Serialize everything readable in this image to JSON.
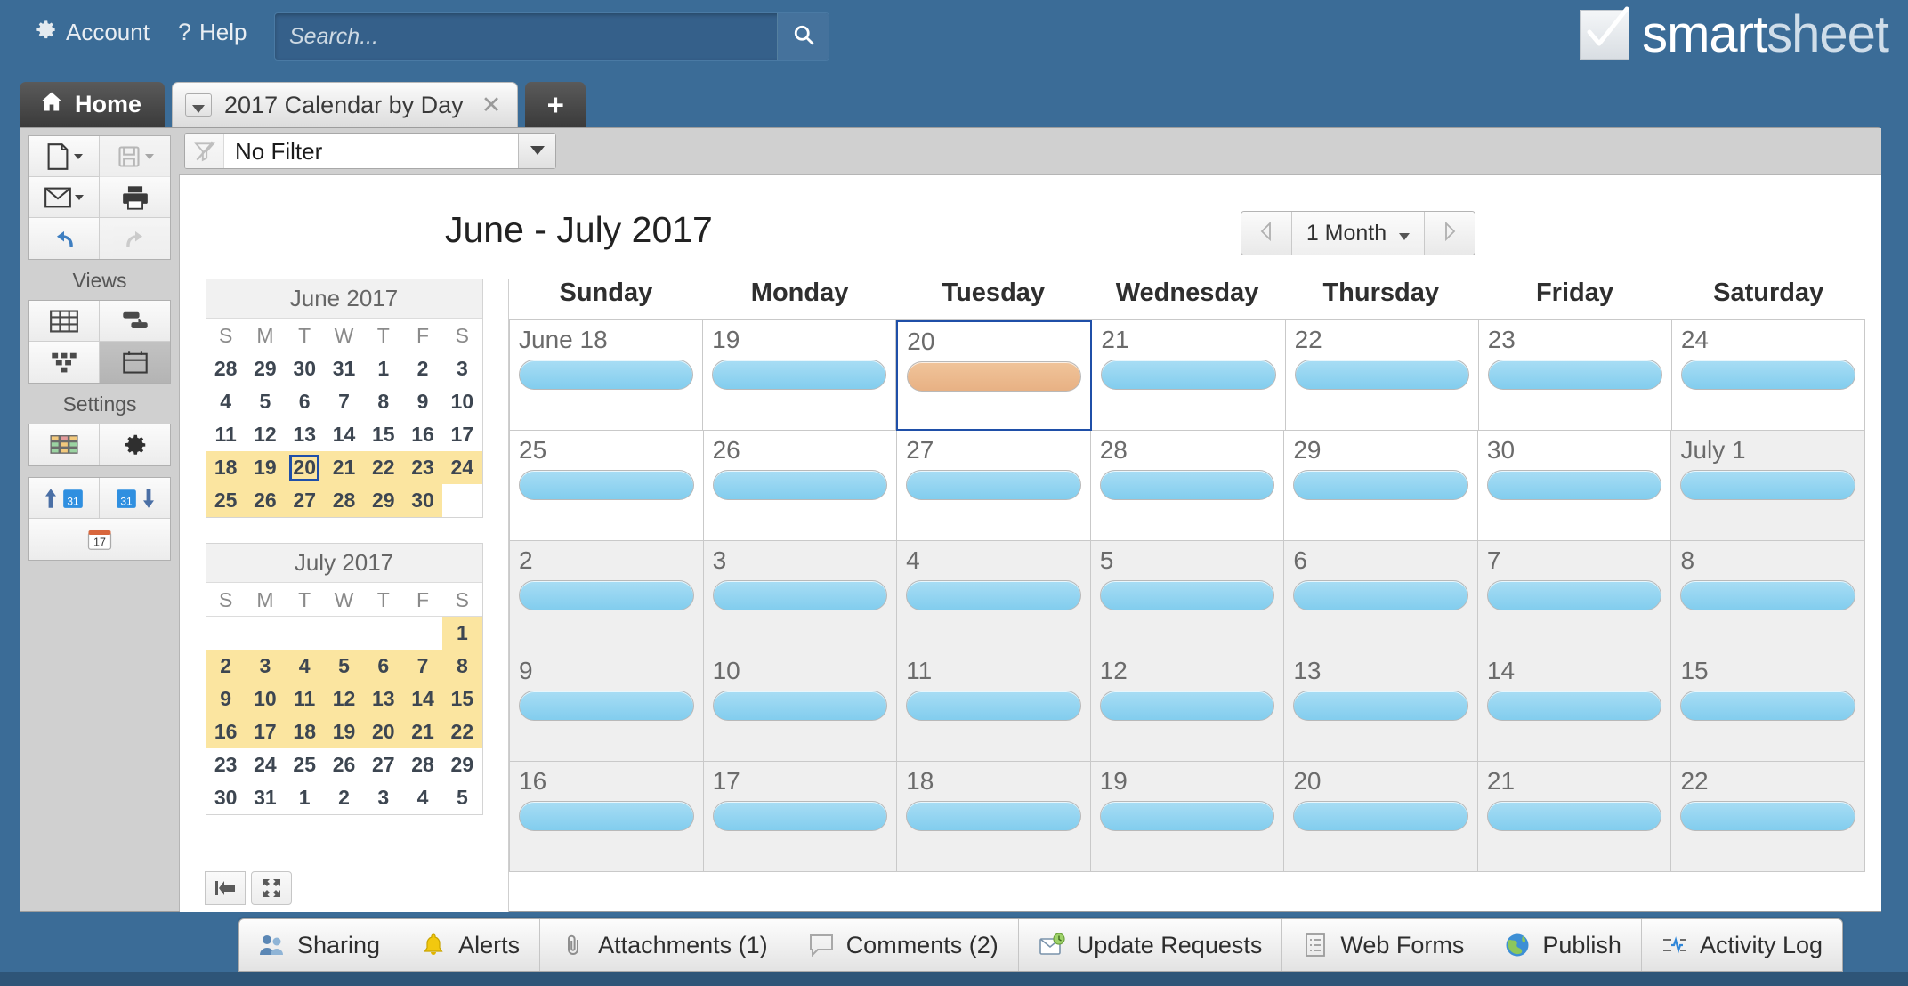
{
  "topbar": {
    "account_label": "Account",
    "account_icon": "gear-icon",
    "help_label": "Help",
    "help_icon": "question-mark-icon",
    "search_placeholder": "Search...",
    "search_value": "",
    "search_icon": "magnifier-icon",
    "brand_primary": "smart",
    "brand_secondary": "sheet",
    "brand_icon": "checkmark-box-icon",
    "background_color": "#3b6c97"
  },
  "tabs": {
    "home_label": "Home",
    "home_icon": "house-icon",
    "sheet_label": "2017 Calendar by Day",
    "sheet_caret_icon": "chevron-down-icon",
    "sheet_close_icon": "close-x-icon",
    "add_tab_label": "+"
  },
  "rail": {
    "tools": [
      {
        "name": "new-sheet-button",
        "icon": "page-icon",
        "caret": true,
        "disabled": false
      },
      {
        "name": "save-button",
        "icon": "floppy-disk-icon",
        "caret": true,
        "disabled": true
      },
      {
        "name": "send-email-button",
        "icon": "envelope-icon",
        "caret": true,
        "disabled": false
      },
      {
        "name": "print-button",
        "icon": "printer-icon",
        "caret": false,
        "disabled": false
      },
      {
        "name": "undo-button",
        "icon": "undo-arrow-icon",
        "caret": false,
        "disabled": false
      },
      {
        "name": "redo-button",
        "icon": "redo-arrow-icon",
        "caret": false,
        "disabled": true
      }
    ],
    "views_label": "Views",
    "views": [
      {
        "name": "grid-view-button",
        "icon": "grid-table-icon",
        "active": false
      },
      {
        "name": "gantt-view-button",
        "icon": "gantt-bar-icon",
        "active": false
      },
      {
        "name": "card-view-button",
        "icon": "card-blocks-icon",
        "active": false
      },
      {
        "name": "calendar-view-button",
        "icon": "calendar-31-icon",
        "active": true
      }
    ],
    "settings_label": "Settings",
    "settings": [
      {
        "name": "conditional-formatting-button",
        "icon": "color-table-icon"
      },
      {
        "name": "project-settings-button",
        "icon": "gear-icon"
      },
      {
        "name": "import-calendar-button",
        "icon": "calendar-up-arrow-icon"
      },
      {
        "name": "export-calendar-button",
        "icon": "calendar-down-arrow-icon"
      },
      {
        "name": "calendar-app-button",
        "icon": "desk-calendar-17-icon"
      }
    ]
  },
  "filter": {
    "icon": "filter-off-icon",
    "value": "No Filter",
    "dropdown_icon": "chevron-down-icon"
  },
  "calendar": {
    "title": "June - July 2017",
    "prev_icon": "triangle-left-icon",
    "next_icon": "triangle-right-icon",
    "range_label": "1 Month",
    "range_caret_icon": "chevron-down-icon",
    "day_headers": [
      "Sunday",
      "Monday",
      "Tuesday",
      "Wednesday",
      "Thursday",
      "Friday",
      "Saturday"
    ],
    "event_color": "#8fd3f0",
    "today_event_color": "#eab184",
    "today_outline_color": "#1f4fa8",
    "weeks": [
      [
        {
          "label": "June 18",
          "offmonth": false,
          "today": false,
          "bar": "blue"
        },
        {
          "label": "19",
          "offmonth": false,
          "today": false,
          "bar": "blue"
        },
        {
          "label": "20",
          "offmonth": false,
          "today": true,
          "bar": "orange"
        },
        {
          "label": "21",
          "offmonth": false,
          "today": false,
          "bar": "blue"
        },
        {
          "label": "22",
          "offmonth": false,
          "today": false,
          "bar": "blue"
        },
        {
          "label": "23",
          "offmonth": false,
          "today": false,
          "bar": "blue"
        },
        {
          "label": "24",
          "offmonth": false,
          "today": false,
          "bar": "blue"
        }
      ],
      [
        {
          "label": "25",
          "offmonth": false,
          "today": false,
          "bar": "blue"
        },
        {
          "label": "26",
          "offmonth": false,
          "today": false,
          "bar": "blue"
        },
        {
          "label": "27",
          "offmonth": false,
          "today": false,
          "bar": "blue"
        },
        {
          "label": "28",
          "offmonth": false,
          "today": false,
          "bar": "blue"
        },
        {
          "label": "29",
          "offmonth": false,
          "today": false,
          "bar": "blue"
        },
        {
          "label": "30",
          "offmonth": false,
          "today": false,
          "bar": "blue"
        },
        {
          "label": "July 1",
          "offmonth": true,
          "today": false,
          "bar": "blue"
        }
      ],
      [
        {
          "label": "2",
          "offmonth": true,
          "today": false,
          "bar": "blue"
        },
        {
          "label": "3",
          "offmonth": true,
          "today": false,
          "bar": "blue"
        },
        {
          "label": "4",
          "offmonth": true,
          "today": false,
          "bar": "blue"
        },
        {
          "label": "5",
          "offmonth": true,
          "today": false,
          "bar": "blue"
        },
        {
          "label": "6",
          "offmonth": true,
          "today": false,
          "bar": "blue"
        },
        {
          "label": "7",
          "offmonth": true,
          "today": false,
          "bar": "blue"
        },
        {
          "label": "8",
          "offmonth": true,
          "today": false,
          "bar": "blue"
        }
      ],
      [
        {
          "label": "9",
          "offmonth": true,
          "today": false,
          "bar": "blue"
        },
        {
          "label": "10",
          "offmonth": true,
          "today": false,
          "bar": "blue"
        },
        {
          "label": "11",
          "offmonth": true,
          "today": false,
          "bar": "blue"
        },
        {
          "label": "12",
          "offmonth": true,
          "today": false,
          "bar": "blue"
        },
        {
          "label": "13",
          "offmonth": true,
          "today": false,
          "bar": "blue"
        },
        {
          "label": "14",
          "offmonth": true,
          "today": false,
          "bar": "blue"
        },
        {
          "label": "15",
          "offmonth": true,
          "today": false,
          "bar": "blue"
        }
      ],
      [
        {
          "label": "16",
          "offmonth": true,
          "today": false,
          "bar": "blue"
        },
        {
          "label": "17",
          "offmonth": true,
          "today": false,
          "bar": "blue"
        },
        {
          "label": "18",
          "offmonth": true,
          "today": false,
          "bar": "blue"
        },
        {
          "label": "19",
          "offmonth": true,
          "today": false,
          "bar": "blue"
        },
        {
          "label": "20",
          "offmonth": true,
          "today": false,
          "bar": "blue"
        },
        {
          "label": "21",
          "offmonth": true,
          "today": false,
          "bar": "blue"
        },
        {
          "label": "22",
          "offmonth": true,
          "today": false,
          "bar": "blue"
        }
      ]
    ]
  },
  "minicals": [
    {
      "title": "June 2017",
      "dow": [
        "S",
        "M",
        "T",
        "W",
        "T",
        "F",
        "S"
      ],
      "highlight_color": "#fbe5a0",
      "rows": [
        [
          {
            "d": "28"
          },
          {
            "d": "29"
          },
          {
            "d": "30"
          },
          {
            "d": "31"
          },
          {
            "d": "1"
          },
          {
            "d": "2"
          },
          {
            "d": "3"
          }
        ],
        [
          {
            "d": "4"
          },
          {
            "d": "5"
          },
          {
            "d": "6"
          },
          {
            "d": "7"
          },
          {
            "d": "8"
          },
          {
            "d": "9"
          },
          {
            "d": "10"
          }
        ],
        [
          {
            "d": "11"
          },
          {
            "d": "12"
          },
          {
            "d": "13"
          },
          {
            "d": "14"
          },
          {
            "d": "15"
          },
          {
            "d": "16"
          },
          {
            "d": "17"
          }
        ],
        [
          {
            "d": "18",
            "hl": true
          },
          {
            "d": "19",
            "hl": true
          },
          {
            "d": "20",
            "hl": true,
            "sel": true
          },
          {
            "d": "21",
            "hl": true
          },
          {
            "d": "22",
            "hl": true
          },
          {
            "d": "23",
            "hl": true
          },
          {
            "d": "24",
            "hl": true
          }
        ],
        [
          {
            "d": "25",
            "hl": true
          },
          {
            "d": "26",
            "hl": true
          },
          {
            "d": "27",
            "hl": true
          },
          {
            "d": "28",
            "hl": true
          },
          {
            "d": "29",
            "hl": true
          },
          {
            "d": "30",
            "hl": true
          },
          {
            "d": ""
          }
        ]
      ]
    },
    {
      "title": "July 2017",
      "dow": [
        "S",
        "M",
        "T",
        "W",
        "T",
        "F",
        "S"
      ],
      "highlight_color": "#fbe5a0",
      "rows": [
        [
          {
            "d": ""
          },
          {
            "d": ""
          },
          {
            "d": ""
          },
          {
            "d": ""
          },
          {
            "d": ""
          },
          {
            "d": ""
          },
          {
            "d": "1",
            "hl": true
          }
        ],
        [
          {
            "d": "2",
            "hl": true
          },
          {
            "d": "3",
            "hl": true
          },
          {
            "d": "4",
            "hl": true
          },
          {
            "d": "5",
            "hl": true
          },
          {
            "d": "6",
            "hl": true
          },
          {
            "d": "7",
            "hl": true
          },
          {
            "d": "8",
            "hl": true
          }
        ],
        [
          {
            "d": "9",
            "hl": true
          },
          {
            "d": "10",
            "hl": true
          },
          {
            "d": "11",
            "hl": true
          },
          {
            "d": "12",
            "hl": true
          },
          {
            "d": "13",
            "hl": true
          },
          {
            "d": "14",
            "hl": true
          },
          {
            "d": "15",
            "hl": true
          }
        ],
        [
          {
            "d": "16",
            "hl": true
          },
          {
            "d": "17",
            "hl": true
          },
          {
            "d": "18",
            "hl": true
          },
          {
            "d": "19",
            "hl": true
          },
          {
            "d": "20",
            "hl": true
          },
          {
            "d": "21",
            "hl": true
          },
          {
            "d": "22",
            "hl": true
          }
        ],
        [
          {
            "d": "23"
          },
          {
            "d": "24"
          },
          {
            "d": "25"
          },
          {
            "d": "26"
          },
          {
            "d": "27"
          },
          {
            "d": "28"
          },
          {
            "d": "29"
          }
        ],
        [
          {
            "d": "30"
          },
          {
            "d": "31"
          },
          {
            "d": "1"
          },
          {
            "d": "2"
          },
          {
            "d": "3"
          },
          {
            "d": "4"
          },
          {
            "d": "5"
          }
        ]
      ]
    }
  ],
  "mini_footer": [
    {
      "name": "collapse-panel-button",
      "icon": "collapse-left-icon"
    },
    {
      "name": "full-screen-button",
      "icon": "expand-arrows-icon"
    }
  ],
  "bottombar": [
    {
      "name": "sharing-button",
      "label": "Sharing",
      "icon": "people-icon"
    },
    {
      "name": "alerts-button",
      "label": "Alerts",
      "icon": "bell-icon"
    },
    {
      "name": "attachments-button",
      "label": "Attachments (1)",
      "icon": "paperclip-icon"
    },
    {
      "name": "comments-button",
      "label": "Comments (2)",
      "icon": "speech-bubble-icon"
    },
    {
      "name": "update-requests-button",
      "label": "Update Requests",
      "icon": "envelope-refresh-icon"
    },
    {
      "name": "web-forms-button",
      "label": "Web Forms",
      "icon": "form-list-icon"
    },
    {
      "name": "publish-button",
      "label": "Publish",
      "icon": "globe-icon"
    },
    {
      "name": "activity-log-button",
      "label": "Activity Log",
      "icon": "activity-pulse-icon"
    }
  ]
}
